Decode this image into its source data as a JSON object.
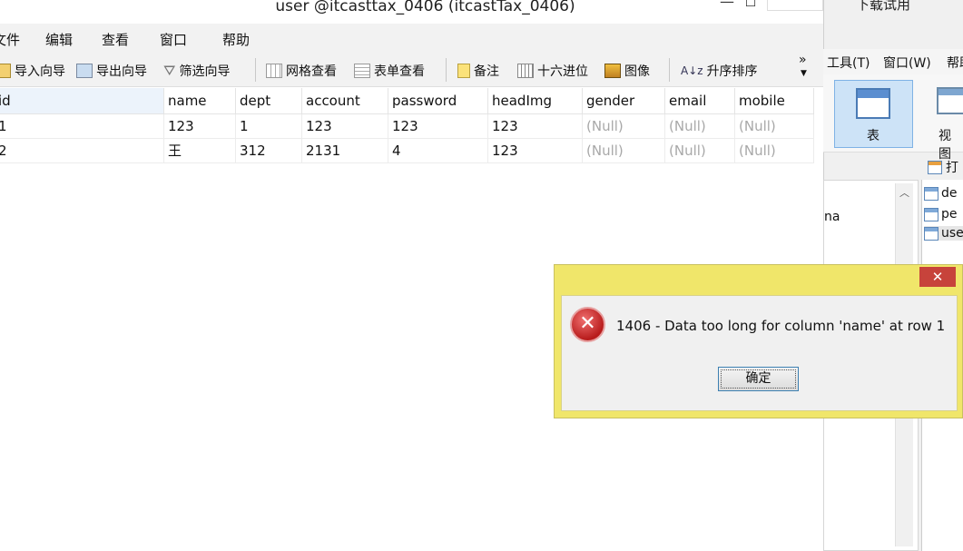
{
  "window": {
    "title": "user @itcasttax_0406 (itcastTax_0406)",
    "minimize": "—",
    "maximize": "☐",
    "close": "✕"
  },
  "menu": [
    "文件",
    "编辑",
    "查看",
    "窗口",
    "帮助"
  ],
  "toolbar": {
    "import": "导入向导",
    "export": "导出向导",
    "filter": "筛选向导",
    "grid_view": "网格查看",
    "form_view": "表单查看",
    "note": "备注",
    "hex": "十六进位",
    "image": "图像",
    "sort_asc": "升序排序",
    "more": "»"
  },
  "table": {
    "columns": [
      "id",
      "name",
      "dept",
      "account",
      "password",
      "headImg",
      "gender",
      "email",
      "mobile"
    ],
    "rows": [
      [
        "1",
        "123",
        "1",
        "123",
        "123",
        "123",
        "(Null)",
        "(Null)",
        "(Null)"
      ],
      [
        "2",
        "王",
        "312",
        "2131",
        "4",
        "123",
        "(Null)",
        "(Null)",
        "(Null)"
      ]
    ]
  },
  "right_panel": {
    "top_text": "下载试用",
    "menu": [
      "工具(T)",
      "窗口(W)",
      "帮助"
    ],
    "table_button": "表",
    "view_button": "视图",
    "open_label": "打",
    "list_text": "na",
    "tree_items": [
      "de",
      "pe",
      "use"
    ]
  },
  "dialog": {
    "close": "✕",
    "message": "1406 - Data too long for column 'name' at row 1",
    "ok": "确定"
  }
}
